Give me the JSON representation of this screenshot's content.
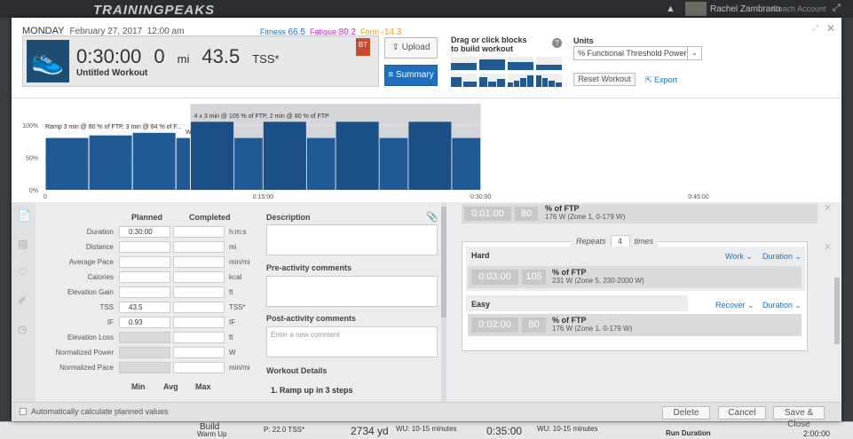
{
  "app": {
    "logo": "TRAININGPEAKS",
    "user_name": "Rachel Zambrano",
    "coach_account": "Coach Account"
  },
  "header": {
    "day": "MONDAY",
    "date": "February 27, 2017",
    "time": "12:00 am",
    "fitness_label": "Fitness",
    "fitness_value": "66.5",
    "fatigue_label": "Fatigue",
    "fatigue_value": "80.2",
    "form_label": "Form",
    "form_value": "-14.3"
  },
  "summary": {
    "duration": "0:30:00",
    "distance": "0",
    "distance_unit": "mi",
    "tss": "43.5",
    "tss_unit": "TSS*",
    "workout_name": "Untitled Workout",
    "badge": "BT"
  },
  "toolbar": {
    "upload_label": "Upload",
    "summary_label": "Summary",
    "drag_label_1": "Drag or click blocks",
    "drag_label_2": "to build workout",
    "units_label": "Units",
    "units_value": "% Functional Threshold Power",
    "reset_label": "Reset Workout",
    "export_label": "Export"
  },
  "chart_data": {
    "type": "bar",
    "y_ticks": [
      "100%",
      "50%",
      "0%"
    ],
    "x_ticks": [
      "0",
      "0:15:00",
      "0:30:00",
      "0:45:00"
    ],
    "segment_labels": [
      "Ramp 3 min @ 80 % of FTP, 3 min @ 84 % of F...",
      "W...",
      "4 x 3 min @ 105 % of FTP, 2 min @ 80 % of FTP"
    ],
    "blocks": [
      {
        "start_min": 0,
        "duration_min": 3,
        "pct_ftp": 80
      },
      {
        "start_min": 3,
        "duration_min": 3,
        "pct_ftp": 84
      },
      {
        "start_min": 6,
        "duration_min": 3,
        "pct_ftp": 88
      },
      {
        "start_min": 9,
        "duration_min": 1,
        "pct_ftp": 80
      },
      {
        "start_min": 10,
        "duration_min": 3,
        "pct_ftp": 105
      },
      {
        "start_min": 13,
        "duration_min": 2,
        "pct_ftp": 80
      },
      {
        "start_min": 15,
        "duration_min": 3,
        "pct_ftp": 105
      },
      {
        "start_min": 18,
        "duration_min": 2,
        "pct_ftp": 80
      },
      {
        "start_min": 20,
        "duration_min": 3,
        "pct_ftp": 105
      },
      {
        "start_min": 23,
        "duration_min": 2,
        "pct_ftp": 80
      },
      {
        "start_min": 25,
        "duration_min": 3,
        "pct_ftp": 105
      },
      {
        "start_min": 28,
        "duration_min": 2,
        "pct_ftp": 80
      }
    ],
    "x_max_min": 48,
    "ylim": [
      0,
      100
    ]
  },
  "form": {
    "planned_header": "Planned",
    "completed_header": "Completed",
    "rows": [
      {
        "label": "Duration",
        "planned": "0:30:00",
        "unit": "h:m:s"
      },
      {
        "label": "Distance",
        "planned": "",
        "unit": "mi"
      },
      {
        "label": "Average Pace",
        "planned": "",
        "unit": "min/mi"
      },
      {
        "label": "Calories",
        "planned": "",
        "unit": "kcal"
      },
      {
        "label": "Elevation Gain",
        "planned": "",
        "unit": "ft"
      },
      {
        "label": "TSS",
        "planned": "43.5",
        "unit": "TSS*"
      },
      {
        "label": "IF",
        "planned": "0.93",
        "unit": "IF"
      },
      {
        "label": "Elevation Loss",
        "planned": "",
        "unit": "ft"
      },
      {
        "label": "Normalized Power",
        "planned": "",
        "unit": "W"
      },
      {
        "label": "Normalized Pace",
        "planned": "",
        "unit": "min/mi"
      }
    ],
    "min_header": "Min",
    "avg_header": "Avg",
    "max_header": "Max",
    "description_label": "Description",
    "pre_comments_label": "Pre-activity comments",
    "post_comments_label": "Post-activity comments",
    "comment_placeholder": "Enter a new comment",
    "details_label": "Workout Details",
    "details_item": "1. Ramp up in 3 steps"
  },
  "builder": {
    "top_step": {
      "duration": "0:01:00",
      "value": "80",
      "unit": "% of FTP",
      "zone": "176 W (Zone 1, 0-179 W)"
    },
    "repeats_label": "Repeats",
    "repeats_value": "4",
    "times_label": "times",
    "hard": {
      "name": "Hard",
      "type_label": "Work",
      "duration_label": "Duration",
      "duration": "0:03:00",
      "value": "105",
      "unit": "% of FTP",
      "zone": "231 W (Zone 5, 230-2000 W)"
    },
    "easy": {
      "name": "Easy",
      "type_label": "Recover",
      "duration_label": "Duration",
      "duration": "0:02:00",
      "value": "80",
      "unit": "% of FTP",
      "zone": "176 W (Zone 1, 0-179 W)"
    }
  },
  "footer": {
    "auto_calc_label": "Automatically calculate planned values",
    "delete_label": "Delete",
    "cancel_label": "Cancel",
    "save_label": "Save & Close"
  },
  "background": {
    "b1": "Build",
    "b2": "Warm Up",
    "b3": "P: 22.0 TSS*",
    "b4": "2734 yd",
    "b5": "WU: 10-15 minutes",
    "b6": "0:35:00",
    "b7": "WU: 10-15 minutes",
    "b8": "Run Duration",
    "b9": "2:00:00"
  }
}
